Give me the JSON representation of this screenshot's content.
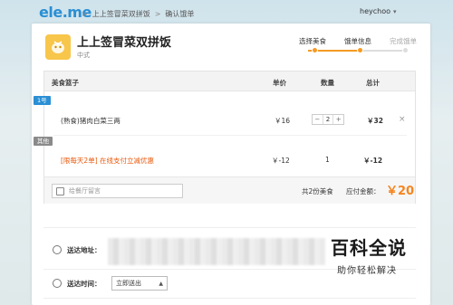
{
  "topbar": {
    "logo": "ele.me",
    "breadcrumbs": [
      "上上签冒菜双拼饭",
      "确认饿单"
    ],
    "breadcrumb_separator": ">",
    "username": "heychoo",
    "user_caret": "▾"
  },
  "shop": {
    "name": "上上签冒菜双拼饭",
    "tag": "中式"
  },
  "steps": {
    "labels": [
      "选择美食",
      "饿单信息",
      "完成饿单"
    ]
  },
  "cart": {
    "headers": {
      "item": "美食篮子",
      "price": "单价",
      "qty": "数量",
      "total": "总计"
    },
    "groups": [
      {
        "badge": "1号",
        "rows": [
          {
            "name": "(熟食)猪肉白菜三两",
            "price": "￥16",
            "qty": "2",
            "total": "￥32",
            "remove": "×"
          }
        ]
      },
      {
        "badge": "其他",
        "rows": [
          {
            "name": "[限每天2单] 在线支付立减优惠",
            "price": "￥-12",
            "qty": "1",
            "total": "￥-12"
          }
        ]
      }
    ],
    "stepper": {
      "minus": "−",
      "plus": "+"
    },
    "note_placeholder": "给餐厅留言",
    "count_text": "共2份美食",
    "total_label": "应付金额：",
    "total_value": "￥20"
  },
  "delivery": {
    "address_label": "送达地址：",
    "time_label": "送达时间：",
    "time_value": "立即送出"
  },
  "watermark": {
    "title": "百科全说",
    "subtitle": "助你轻松解决"
  },
  "colors": {
    "accent": "#f5851f",
    "brand": "#2a8fd4",
    "promo": "#e8590c"
  }
}
